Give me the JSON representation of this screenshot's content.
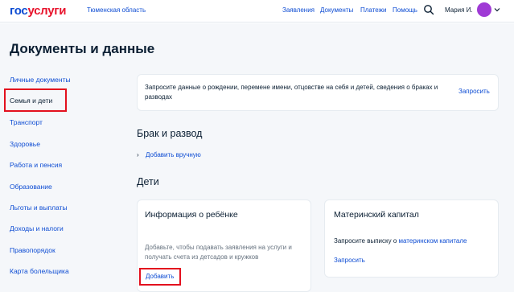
{
  "header": {
    "logo_part1": "гос",
    "logo_part2": "услуги",
    "region": "Тюменская область",
    "nav": [
      "Заявления",
      "Документы",
      "Платежи",
      "Помощь"
    ],
    "search_icon": "search-icon",
    "user_name": "Мария И.",
    "avatar_color": "#9f3ad5"
  },
  "page": {
    "title": "Документы и данные"
  },
  "sidebar": {
    "items": [
      {
        "label": "Личные документы"
      },
      {
        "label": "Семья и дети",
        "active": true
      },
      {
        "label": "Транспорт"
      },
      {
        "label": "Здоровье"
      },
      {
        "label": "Работа и пенсия"
      },
      {
        "label": "Образование"
      },
      {
        "label": "Льготы и выплаты"
      },
      {
        "label": "Доходы и налоги"
      },
      {
        "label": "Правопорядок"
      },
      {
        "label": "Карта болельщика"
      }
    ]
  },
  "request_card": {
    "text": "Запросите данные о рождении, перемене имени, отцовстве на себя и детей, сведения о браках и разводах",
    "button": "Запросить"
  },
  "marriage": {
    "title": "Брак и развод",
    "add_manual": "Добавить вручную"
  },
  "children": {
    "title": "Дети",
    "child_card": {
      "title": "Информация о ребёнке",
      "text": "Добавьте, чтобы подавать заявления на услуги и получать счета из детсадов и кружков",
      "button": "Добавить"
    },
    "capital_card": {
      "title": "Материнский капитал",
      "text_before": "Запросите выписку о ",
      "text_link": "материнском капитале",
      "button": "Запросить"
    }
  },
  "colors": {
    "accent": "#0d4cd3",
    "highlight": "#e3101e",
    "logo_red": "#e8132c"
  }
}
